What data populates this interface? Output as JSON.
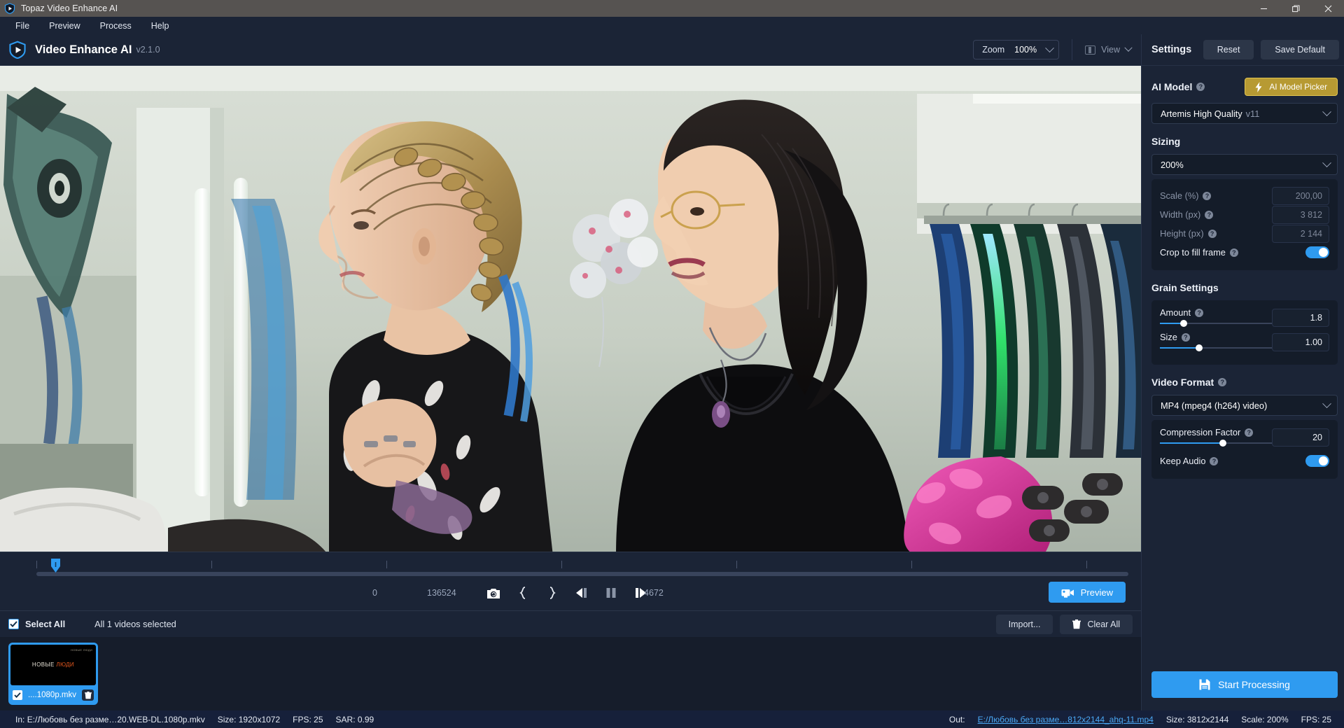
{
  "window": {
    "title": "Topaz Video Enhance AI",
    "controls": {
      "minimize": "minimize-icon",
      "maximize": "restore-icon",
      "close": "close-icon"
    }
  },
  "menubar": {
    "items": [
      "File",
      "Preview",
      "Process",
      "Help"
    ]
  },
  "appbar": {
    "brand": "Video Enhance AI",
    "version": "v2.1.0",
    "zoom_label": "Zoom",
    "zoom_value": "100%",
    "view_label": "View"
  },
  "timeline": {
    "start_frame": "0",
    "total_frames": "136524",
    "current_frame": "4672",
    "buttons": [
      {
        "name": "snapshot-button",
        "glyph": "camera"
      },
      {
        "name": "set-in-point-button",
        "glyph": "{"
      },
      {
        "name": "set-out-point-button",
        "glyph": "}"
      },
      {
        "name": "step-back-button",
        "glyph": "prev"
      },
      {
        "name": "pause-button",
        "glyph": "pause"
      },
      {
        "name": "step-forward-button",
        "glyph": "next"
      }
    ],
    "preview_label": "Preview"
  },
  "selection": {
    "select_all_label": "Select All",
    "count_text": "All 1 videos selected",
    "import_label": "Import...",
    "clear_all_label": "Clear All"
  },
  "filestrip": {
    "items": [
      {
        "filename": "....1080p.mkv",
        "thumb_text_white": "НОВЫЕ",
        "thumb_text_orange": "ЛЮДИ",
        "thumb_corner_text": "НОВЫЕ ЛЮДИ",
        "checked": true
      }
    ]
  },
  "settings": {
    "title": "Settings",
    "reset_label": "Reset",
    "save_default_label": "Save Default",
    "ai_model": {
      "section_label": "AI Model",
      "picker_label": "AI Model Picker",
      "selected": "Artemis High Quality",
      "selected_version": "v11"
    },
    "sizing": {
      "section_label": "Sizing",
      "preset": "200%",
      "scale_label": "Scale (%)",
      "scale_value": "200,00",
      "width_label": "Width (px)",
      "width_value": "3 812",
      "height_label": "Height (px)",
      "height_value": "2 144",
      "crop_label": "Crop to fill frame",
      "crop_enabled": true
    },
    "grain": {
      "section_label": "Grain Settings",
      "amount_label": "Amount",
      "amount_value": "1.8",
      "amount_pct": 21,
      "size_label": "Size",
      "size_value": "1.00",
      "size_pct": 35
    },
    "video_format": {
      "section_label": "Video Format",
      "format": "MP4 (mpeg4 (h264) video)",
      "compression_label": "Compression Factor",
      "compression_value": "20",
      "compression_pct": 56,
      "keep_audio_label": "Keep Audio",
      "keep_audio_enabled": true
    },
    "start_label": "Start Processing"
  },
  "statusbar": {
    "in_prefix": "In:",
    "in_path": "E:/Любовь без разме…20.WEB-DL.1080p.mkv",
    "in_size_label": "Size: 1920x1072",
    "in_fps_label": "FPS: 25",
    "in_sar_label": "SAR: 0.99",
    "out_prefix": "Out:",
    "out_path": "E:/Любовь без разме…812x2144_ahq-11.mp4",
    "out_size_label": "Size: 3812x2144",
    "out_scale_label": "Scale: 200%",
    "out_fps_label": "FPS: 25"
  },
  "colors": {
    "accent": "#2f9bf0",
    "gold": "#b79a33",
    "panel": "#1b2436",
    "field": "#141c29"
  }
}
